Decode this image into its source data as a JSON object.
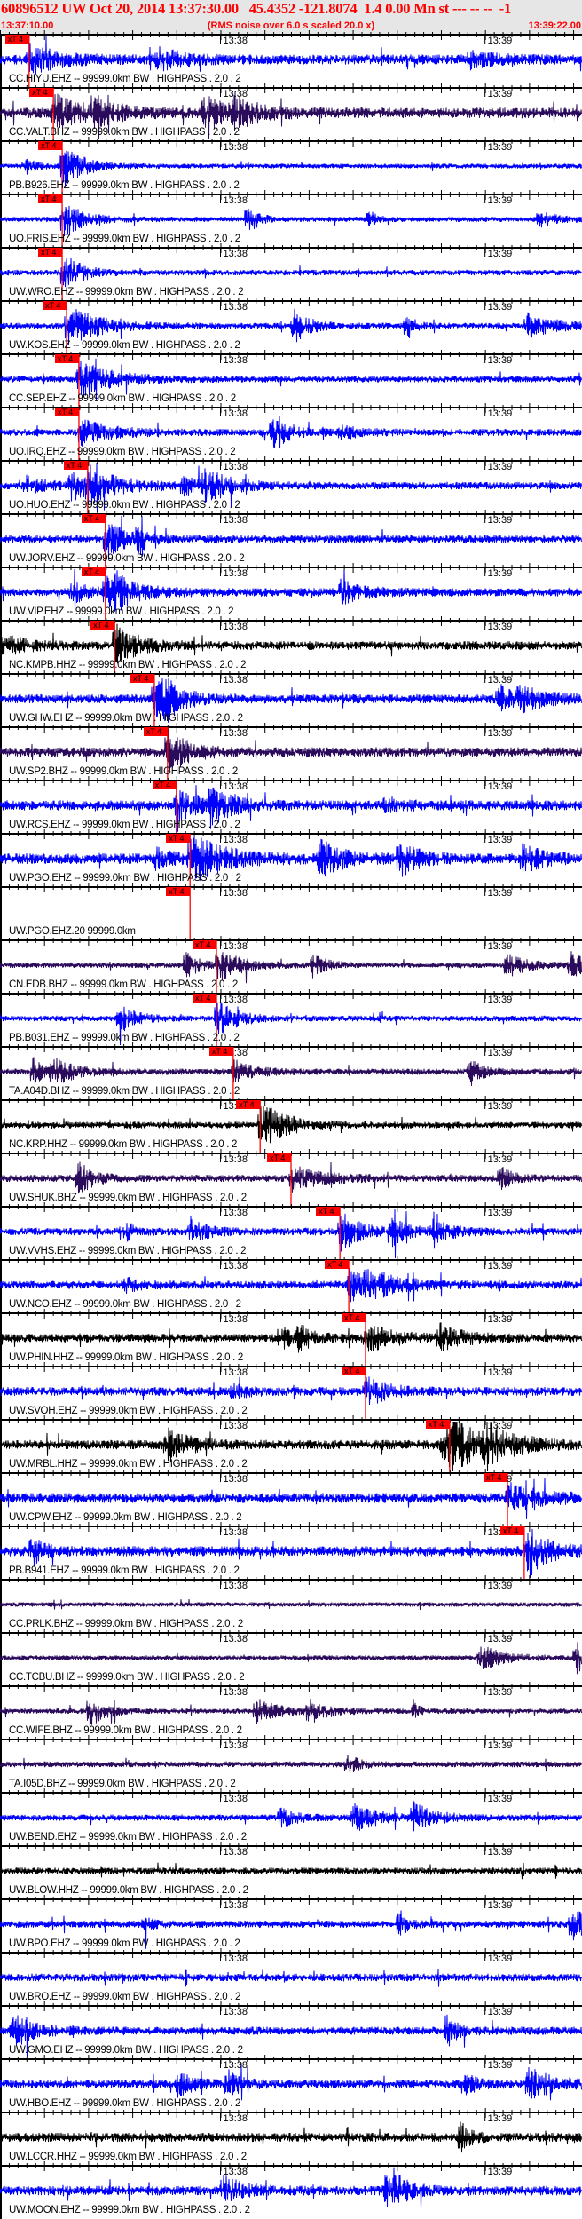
{
  "header": {
    "title": "60896512 UW Oct 20, 2014 13:37:30.00   45.4352 -121.8074  1.4 0.00 Mn st --- -- --  -1",
    "start_time": "13:37:10.00",
    "scaling_note": "(RMS noise over 6.0 s scaled 20.0 x)",
    "end_time": "13:39:22.00"
  },
  "colors": {
    "blue": "#0000ff",
    "purple": "#2a0b5c",
    "black": "#000000",
    "pick": "#ff0000",
    "header_bg": "#e6e6e6"
  },
  "chart_data": {
    "type": "line",
    "title": "60896512 UW Oct 20, 2014 13:37:30.00",
    "x_range_seconds": [
      0,
      132
    ],
    "x_start": "13:37:10.00",
    "x_end": "13:39:22.00",
    "time_labels": [
      {
        "text": "13:38",
        "seconds": 50
      },
      {
        "text": "13:39",
        "seconds": 110
      }
    ],
    "minor_tick_seconds": 2,
    "major_tick_seconds": 10,
    "pick_label": "xT 4",
    "traces": [
      {
        "label": "CC.HIYU.EHZ -- 99999.0km BW . HIGHPASS . 2.0 . 2",
        "color": "blue",
        "pick_s": 6.6
      },
      {
        "label": "CC.VALT.BHZ -- 99999.0km BW . HIGHPASS . 2.0 . 2",
        "color": "purple",
        "pick_s": 12.1
      },
      {
        "label": "PB.B926.EHZ -- 99999.0km BW . HIGHPASS . 2.0 . 2",
        "color": "blue",
        "pick_s": 14.1
      },
      {
        "label": "UO.FRIS.EHZ -- 99999.0km BW . HIGHPASS . 2.0 . 2",
        "color": "blue",
        "pick_s": 14.1
      },
      {
        "label": "UW.WRO.EHZ -- 99999.0km BW . HIGHPASS . 2.0 . 2",
        "color": "blue",
        "pick_s": 14.1
      },
      {
        "label": "UW.KOS.EHZ -- 99999.0km BW . HIGHPASS . 2.0 . 2",
        "color": "blue",
        "pick_s": 15.1
      },
      {
        "label": "CC.SEP.EHZ -- 99999.0km BW . HIGHPASS . 2.0 . 2",
        "color": "blue",
        "pick_s": 17.9
      },
      {
        "label": "UO.IRQ.EHZ -- 99999.0km BW . HIGHPASS . 2.0 . 2",
        "color": "blue",
        "pick_s": 17.9
      },
      {
        "label": "UO.HUO.EHZ -- 99999.0km BW . HIGHPASS . 2.0 . 2",
        "color": "blue",
        "pick_s": 19.9
      },
      {
        "label": "UW.JORV.EHZ -- 99999.0km BW . HIGHPASS . 2.0 . 2",
        "color": "blue",
        "pick_s": 23.9
      },
      {
        "label": "UW.VIP.EHZ -- 99999.0km BW . HIGHPASS . 2.0 . 2",
        "color": "blue",
        "pick_s": 23.9
      },
      {
        "label": "NC.KMPB.HHZ -- 99999.0km BW . HIGHPASS . 2.0 . 2",
        "color": "black",
        "pick_s": 26.0
      },
      {
        "label": "UW.GHW.EHZ -- 99999.0km BW . HIGHPASS . 2.0 . 2",
        "color": "blue",
        "pick_s": 35.0
      },
      {
        "label": "UW.SP2.BHZ -- 99999.0km BW . HIGHPASS . 2.0 . 2",
        "color": "purple",
        "pick_s": 38.0
      },
      {
        "label": "UW.RCS.EHZ -- 99999.0km BW . HIGHPASS . 2.0 . 2",
        "color": "blue",
        "pick_s": 40.0
      },
      {
        "label": "UW.PGO.EHZ -- 99999.0km BW . HIGHPASS . 2.0 . 2",
        "color": "blue",
        "pick_s": 43.1
      },
      {
        "label": "UW.PGO.EHZ.20 99999.0km",
        "color": "blue",
        "pick_s": 43.1,
        "empty": true
      },
      {
        "label": "CN.EDB.BHZ -- 99999.0km BW . HIGHPASS . 2.0 . 2",
        "color": "purple",
        "pick_s": 49.1
      },
      {
        "label": "PB.B031.EHZ -- 99999.0km BW . HIGHPASS . 2.0 . 2",
        "color": "blue",
        "pick_s": 49.1
      },
      {
        "label": "TA.A04D.BHZ -- 99999.0km BW . HIGHPASS . 2.0 . 2",
        "color": "purple",
        "pick_s": 52.9
      },
      {
        "label": "NC.KRP.HHZ -- 99999.0km BW . HIGHPASS . 2.0 . 2",
        "color": "black",
        "pick_s": 59.0
      },
      {
        "label": "UW.SHUK.BHZ -- 99999.0km BW . HIGHPASS . 2.0 . 2",
        "color": "purple",
        "pick_s": 66.0
      },
      {
        "label": "UW.VVHS.EHZ -- 99999.0km BW . HIGHPASS . 2.0 . 2",
        "color": "blue",
        "pick_s": 77.1
      },
      {
        "label": "UW.NCO.EHZ -- 99999.0km BW . HIGHPASS . 2.0 . 2",
        "color": "blue",
        "pick_s": 79.1
      },
      {
        "label": "UW.PHIN.HHZ -- 99999.0km BW . HIGHPASS . 2.0 . 2",
        "color": "black",
        "pick_s": 82.9
      },
      {
        "label": "UW.SVOH.EHZ -- 99999.0km BW . HIGHPASS . 2.0 . 2",
        "color": "blue",
        "pick_s": 82.9
      },
      {
        "label": "UW.MRBL.HHZ -- 99999.0km BW . HIGHPASS . 2.0 . 2",
        "color": "black",
        "pick_s": 102.0
      },
      {
        "label": "UW.CPW.EHZ -- 99999.0km BW . HIGHPASS . 2.0 . 2",
        "color": "blue",
        "pick_s": 115.1
      },
      {
        "label": "PB.B941.EHZ -- 99999.0km BW . HIGHPASS . 2.0 . 2",
        "color": "blue",
        "pick_s": 118.9
      },
      {
        "label": "CC.PRLK.BHZ -- 99999.0km BW . HIGHPASS . 2.0 . 2",
        "color": "purple"
      },
      {
        "label": "CC.TCBU.BHZ -- 99999.0km BW . HIGHPASS . 2.0 . 2",
        "color": "purple"
      },
      {
        "label": "CC.WIFE.BHZ -- 99999.0km BW . HIGHPASS . 2.0 . 2",
        "color": "purple"
      },
      {
        "label": "TA.I05D.BHZ -- 99999.0km BW . HIGHPASS . 2.0 . 2",
        "color": "purple"
      },
      {
        "label": "UW.BEND.EHZ -- 99999.0km BW . HIGHPASS . 2.0 . 2",
        "color": "blue"
      },
      {
        "label": "UW.BLOW.HHZ -- 99999.0km BW . HIGHPASS . 2.0 . 2",
        "color": "black"
      },
      {
        "label": "UW.BPO.EHZ -- 99999.0km BW . HIGHPASS . 2.0 . 2",
        "color": "blue"
      },
      {
        "label": "UW.BRO.EHZ -- 99999.0km BW . HIGHPASS . 2.0 . 2",
        "color": "blue"
      },
      {
        "label": "UW.GMO.EHZ -- 99999.0km BW . HIGHPASS . 2.0 . 2",
        "color": "blue"
      },
      {
        "label": "UW.HBO.EHZ -- 99999.0km BW . HIGHPASS . 2.0 . 2",
        "color": "blue"
      },
      {
        "label": "UW.LCCR.HHZ -- 99999.0km BW . HIGHPASS . 2.0 . 2",
        "color": "black"
      },
      {
        "label": "UW.MOON.EHZ -- 99999.0km BW . HIGHPASS . 2.0 . 2",
        "color": "blue"
      }
    ]
  }
}
